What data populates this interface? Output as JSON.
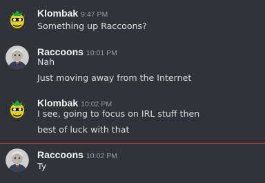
{
  "messages": [
    {
      "author": "Klombak",
      "time": "9:47 PM",
      "avatar": "klombak-avatar-icon",
      "lines": [
        "Something up Raccoons?"
      ]
    },
    {
      "author": "Raccoons",
      "time": "10:01 PM",
      "avatar": "raccoons-avatar-icon",
      "lines": [
        "Nah",
        "Just moving away from the Internet"
      ]
    },
    {
      "author": "Klombak",
      "time": "10:02 PM",
      "avatar": "klombak-avatar-icon",
      "lines": [
        "I see, going to focus on IRL stuff then",
        "best of luck with that"
      ]
    },
    {
      "author": "Raccoons",
      "time": "10:02 PM",
      "avatar": "raccoons-avatar-icon",
      "lines": [
        "Ty"
      ]
    }
  ],
  "new_messages_divider": true,
  "colors": {
    "background": "#313338",
    "divider": "#d8343f",
    "username": "#f2f3f5",
    "text": "#dbdee1",
    "timestamp": "#949ba4"
  }
}
